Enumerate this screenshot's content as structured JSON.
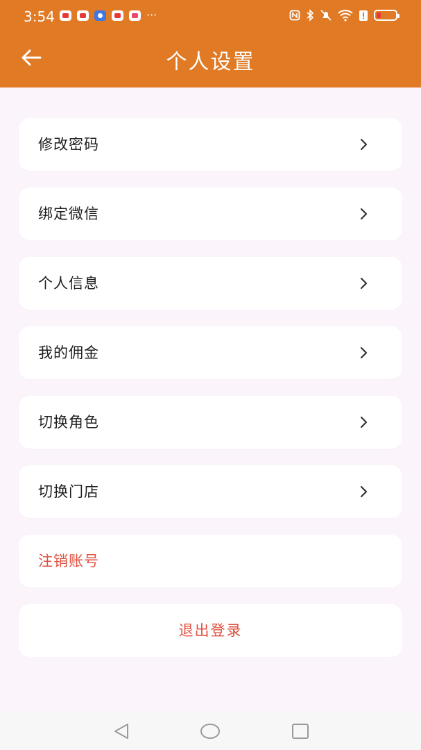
{
  "status_bar": {
    "time": "3:54",
    "notification_icons": [
      "huawei-app-icon",
      "red-app-icon",
      "shield-app-icon",
      "weibo-app-icon",
      "book-app-icon"
    ],
    "ellipsis": "···",
    "system_icons": [
      "nfc-icon",
      "bluetooth-icon",
      "mute-icon",
      "wifi-icon",
      "battery-alert-icon",
      "battery-icon"
    ]
  },
  "header": {
    "title": "个人设置",
    "background": "#e07a25"
  },
  "menu": {
    "items": [
      {
        "label": "修改密码",
        "danger": false
      },
      {
        "label": "绑定微信",
        "danger": false
      },
      {
        "label": "个人信息",
        "danger": false
      },
      {
        "label": "我的佣金",
        "danger": false
      },
      {
        "label": "切换角色",
        "danger": false
      },
      {
        "label": "切换门店",
        "danger": false
      },
      {
        "label": "注销账号",
        "danger": true
      }
    ],
    "logout_label": "退出登录",
    "danger_color": "#e0503f"
  },
  "navbar": {
    "buttons": [
      "back-nav-icon",
      "home-nav-icon",
      "recents-nav-icon"
    ]
  }
}
